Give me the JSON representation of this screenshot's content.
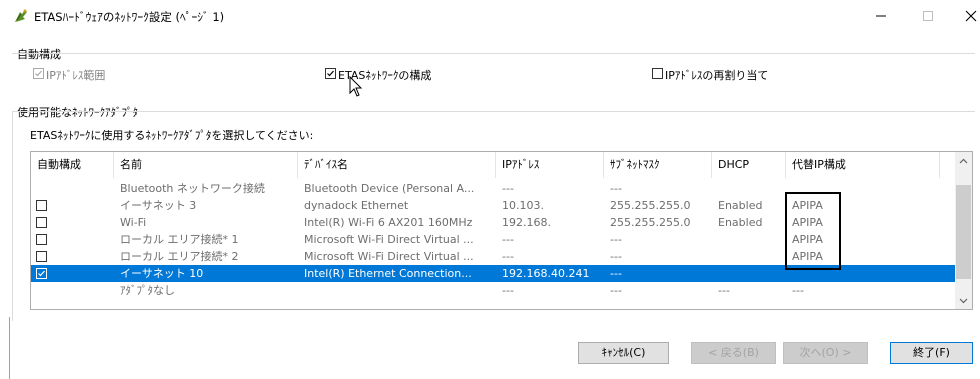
{
  "window": {
    "title": "ETASﾊｰﾄﾞｳｪｱのﾈｯﾄﾜｰｸ設定 (ﾍﾟｰｼﾞ 1)",
    "icon": "etas-hardware-icon",
    "minimize_glyph": "—",
    "maximize_glyph": "☐",
    "close_glyph": "✕"
  },
  "auto_config": {
    "label": "自動構成",
    "options": [
      {
        "label": "IPｱﾄﾞﾚｽ範囲",
        "checked": true,
        "enabled": false
      },
      {
        "label": "ETASﾈｯﾄﾜｰｸの構成",
        "checked": true,
        "enabled": true
      },
      {
        "label": "IPｱﾄﾞﾚｽの再割り当て",
        "checked": false,
        "enabled": true
      }
    ]
  },
  "adapters": {
    "label": "使用可能なﾈｯﾄﾜｰｸｱﾀﾞﾌﾟﾀ",
    "instruction": "ETASﾈｯﾄﾜｰｸに使用するﾈｯﾄﾜｰｸｱﾀﾞﾌﾟﾀを選択してください:",
    "columns": [
      "自動構成",
      "名前",
      "ﾃﾞﾊﾞｲｽ名",
      "IPｱﾄﾞﾚｽ",
      "ｻﾌﾞﾈｯﾄﾏｽｸ",
      "DHCP",
      "代替IP構成"
    ],
    "rows": [
      {
        "checkbox": false,
        "checked": false,
        "name": "Bluetooth ネットワーク接続",
        "device": "Bluetooth Device (Personal A...",
        "ip": "---",
        "mask": "---",
        "dhcp": "",
        "alt": ""
      },
      {
        "checkbox": true,
        "checked": false,
        "name": "イーサネット 3",
        "device": "dynadock Ethernet",
        "ip": "10.103.",
        "mask": "255.255.255.0",
        "dhcp": "Enabled",
        "alt": "APIPA"
      },
      {
        "checkbox": true,
        "checked": false,
        "name": "Wi-Fi",
        "device": "Intel(R) Wi-Fi 6 AX201 160MHz",
        "ip": "192.168.",
        "mask": "255.255.255.0",
        "dhcp": "Enabled",
        "alt": "APIPA"
      },
      {
        "checkbox": true,
        "checked": false,
        "name": "ローカル エリア接続* 1",
        "device": "Microsoft Wi-Fi Direct Virtual ...",
        "ip": "---",
        "mask": "---",
        "dhcp": "",
        "alt": "APIPA"
      },
      {
        "checkbox": true,
        "checked": false,
        "name": "ローカル エリア接続* 2",
        "device": "Microsoft Wi-Fi Direct Virtual ...",
        "ip": "---",
        "mask": "---",
        "dhcp": "",
        "alt": "APIPA"
      },
      {
        "checkbox": true,
        "checked": true,
        "name": "イーサネット 10",
        "device": "Intel(R) Ethernet Connection...",
        "ip": "192.168.40.241",
        "mask": "---",
        "dhcp": "",
        "alt": "",
        "selected": true
      },
      {
        "checkbox": false,
        "checked": false,
        "name": "ｱﾀﾞﾌﾟﾀなし",
        "device": "",
        "ip": "---",
        "mask": "---",
        "dhcp": "---",
        "alt": "---"
      }
    ]
  },
  "buttons": {
    "cancel": "ｷｬﾝｾﾙ(C)",
    "back": "< 戻る(B)",
    "next": "次へ(O) >",
    "finish": "終了(F)"
  },
  "colors": {
    "selection": "#0078d7",
    "highlight_box": "#000000"
  }
}
